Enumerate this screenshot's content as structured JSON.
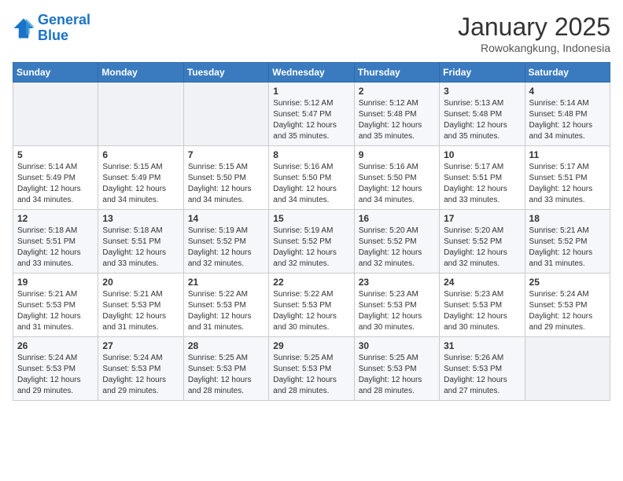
{
  "header": {
    "logo_line1": "General",
    "logo_line2": "Blue",
    "month": "January 2025",
    "location": "Rowokangkung, Indonesia"
  },
  "weekdays": [
    "Sunday",
    "Monday",
    "Tuesday",
    "Wednesday",
    "Thursday",
    "Friday",
    "Saturday"
  ],
  "weeks": [
    [
      {
        "day": "",
        "sunrise": "",
        "sunset": "",
        "daylight": ""
      },
      {
        "day": "",
        "sunrise": "",
        "sunset": "",
        "daylight": ""
      },
      {
        "day": "",
        "sunrise": "",
        "sunset": "",
        "daylight": ""
      },
      {
        "day": "1",
        "sunrise": "Sunrise: 5:12 AM",
        "sunset": "Sunset: 5:47 PM",
        "daylight": "Daylight: 12 hours and 35 minutes."
      },
      {
        "day": "2",
        "sunrise": "Sunrise: 5:12 AM",
        "sunset": "Sunset: 5:48 PM",
        "daylight": "Daylight: 12 hours and 35 minutes."
      },
      {
        "day": "3",
        "sunrise": "Sunrise: 5:13 AM",
        "sunset": "Sunset: 5:48 PM",
        "daylight": "Daylight: 12 hours and 35 minutes."
      },
      {
        "day": "4",
        "sunrise": "Sunrise: 5:14 AM",
        "sunset": "Sunset: 5:48 PM",
        "daylight": "Daylight: 12 hours and 34 minutes."
      }
    ],
    [
      {
        "day": "5",
        "sunrise": "Sunrise: 5:14 AM",
        "sunset": "Sunset: 5:49 PM",
        "daylight": "Daylight: 12 hours and 34 minutes."
      },
      {
        "day": "6",
        "sunrise": "Sunrise: 5:15 AM",
        "sunset": "Sunset: 5:49 PM",
        "daylight": "Daylight: 12 hours and 34 minutes."
      },
      {
        "day": "7",
        "sunrise": "Sunrise: 5:15 AM",
        "sunset": "Sunset: 5:50 PM",
        "daylight": "Daylight: 12 hours and 34 minutes."
      },
      {
        "day": "8",
        "sunrise": "Sunrise: 5:16 AM",
        "sunset": "Sunset: 5:50 PM",
        "daylight": "Daylight: 12 hours and 34 minutes."
      },
      {
        "day": "9",
        "sunrise": "Sunrise: 5:16 AM",
        "sunset": "Sunset: 5:50 PM",
        "daylight": "Daylight: 12 hours and 34 minutes."
      },
      {
        "day": "10",
        "sunrise": "Sunrise: 5:17 AM",
        "sunset": "Sunset: 5:51 PM",
        "daylight": "Daylight: 12 hours and 33 minutes."
      },
      {
        "day": "11",
        "sunrise": "Sunrise: 5:17 AM",
        "sunset": "Sunset: 5:51 PM",
        "daylight": "Daylight: 12 hours and 33 minutes."
      }
    ],
    [
      {
        "day": "12",
        "sunrise": "Sunrise: 5:18 AM",
        "sunset": "Sunset: 5:51 PM",
        "daylight": "Daylight: 12 hours and 33 minutes."
      },
      {
        "day": "13",
        "sunrise": "Sunrise: 5:18 AM",
        "sunset": "Sunset: 5:51 PM",
        "daylight": "Daylight: 12 hours and 33 minutes."
      },
      {
        "day": "14",
        "sunrise": "Sunrise: 5:19 AM",
        "sunset": "Sunset: 5:52 PM",
        "daylight": "Daylight: 12 hours and 32 minutes."
      },
      {
        "day": "15",
        "sunrise": "Sunrise: 5:19 AM",
        "sunset": "Sunset: 5:52 PM",
        "daylight": "Daylight: 12 hours and 32 minutes."
      },
      {
        "day": "16",
        "sunrise": "Sunrise: 5:20 AM",
        "sunset": "Sunset: 5:52 PM",
        "daylight": "Daylight: 12 hours and 32 minutes."
      },
      {
        "day": "17",
        "sunrise": "Sunrise: 5:20 AM",
        "sunset": "Sunset: 5:52 PM",
        "daylight": "Daylight: 12 hours and 32 minutes."
      },
      {
        "day": "18",
        "sunrise": "Sunrise: 5:21 AM",
        "sunset": "Sunset: 5:52 PM",
        "daylight": "Daylight: 12 hours and 31 minutes."
      }
    ],
    [
      {
        "day": "19",
        "sunrise": "Sunrise: 5:21 AM",
        "sunset": "Sunset: 5:53 PM",
        "daylight": "Daylight: 12 hours and 31 minutes."
      },
      {
        "day": "20",
        "sunrise": "Sunrise: 5:21 AM",
        "sunset": "Sunset: 5:53 PM",
        "daylight": "Daylight: 12 hours and 31 minutes."
      },
      {
        "day": "21",
        "sunrise": "Sunrise: 5:22 AM",
        "sunset": "Sunset: 5:53 PM",
        "daylight": "Daylight: 12 hours and 31 minutes."
      },
      {
        "day": "22",
        "sunrise": "Sunrise: 5:22 AM",
        "sunset": "Sunset: 5:53 PM",
        "daylight": "Daylight: 12 hours and 30 minutes."
      },
      {
        "day": "23",
        "sunrise": "Sunrise: 5:23 AM",
        "sunset": "Sunset: 5:53 PM",
        "daylight": "Daylight: 12 hours and 30 minutes."
      },
      {
        "day": "24",
        "sunrise": "Sunrise: 5:23 AM",
        "sunset": "Sunset: 5:53 PM",
        "daylight": "Daylight: 12 hours and 30 minutes."
      },
      {
        "day": "25",
        "sunrise": "Sunrise: 5:24 AM",
        "sunset": "Sunset: 5:53 PM",
        "daylight": "Daylight: 12 hours and 29 minutes."
      }
    ],
    [
      {
        "day": "26",
        "sunrise": "Sunrise: 5:24 AM",
        "sunset": "Sunset: 5:53 PM",
        "daylight": "Daylight: 12 hours and 29 minutes."
      },
      {
        "day": "27",
        "sunrise": "Sunrise: 5:24 AM",
        "sunset": "Sunset: 5:53 PM",
        "daylight": "Daylight: 12 hours and 29 minutes."
      },
      {
        "day": "28",
        "sunrise": "Sunrise: 5:25 AM",
        "sunset": "Sunset: 5:53 PM",
        "daylight": "Daylight: 12 hours and 28 minutes."
      },
      {
        "day": "29",
        "sunrise": "Sunrise: 5:25 AM",
        "sunset": "Sunset: 5:53 PM",
        "daylight": "Daylight: 12 hours and 28 minutes."
      },
      {
        "day": "30",
        "sunrise": "Sunrise: 5:25 AM",
        "sunset": "Sunset: 5:53 PM",
        "daylight": "Daylight: 12 hours and 28 minutes."
      },
      {
        "day": "31",
        "sunrise": "Sunrise: 5:26 AM",
        "sunset": "Sunset: 5:53 PM",
        "daylight": "Daylight: 12 hours and 27 minutes."
      },
      {
        "day": "",
        "sunrise": "",
        "sunset": "",
        "daylight": ""
      }
    ]
  ]
}
